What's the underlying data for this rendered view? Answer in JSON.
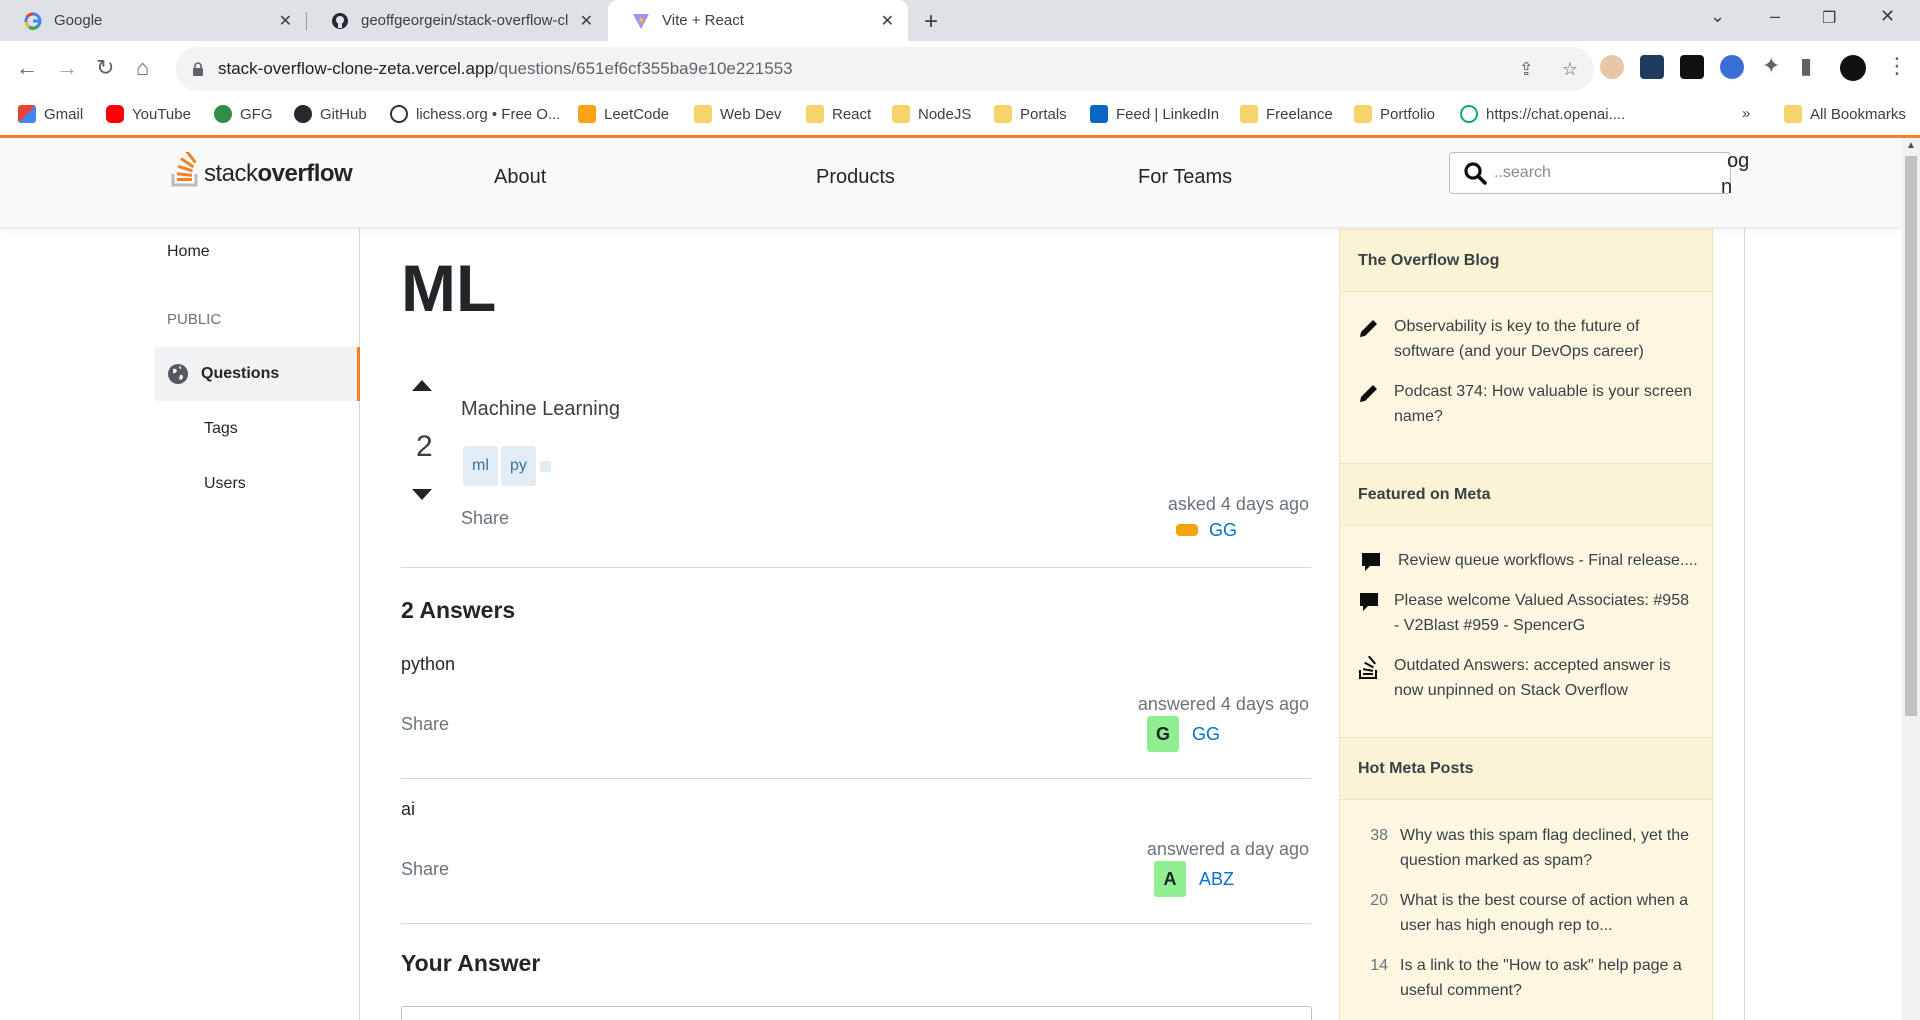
{
  "browser": {
    "tabs": [
      {
        "title": "Google",
        "icon": "google-icon"
      },
      {
        "title": "geoffgeorgein/stack-overflow-cl",
        "icon": "github-icon"
      },
      {
        "title": "Vite + React",
        "icon": "vite-icon",
        "active": true
      }
    ],
    "url_host": "stack-overflow-clone-zeta.vercel.app",
    "url_path": "/questions/651ef6cf355ba9e10e221553",
    "bookmarks": [
      {
        "label": "Gmail",
        "icon": "gmail-icon"
      },
      {
        "label": "YouTube",
        "icon": "youtube-icon"
      },
      {
        "label": "GFG",
        "icon": "gfg-icon"
      },
      {
        "label": "GitHub",
        "icon": "github-icon"
      },
      {
        "label": "lichess.org • Free O...",
        "icon": "lichess-icon"
      },
      {
        "label": "LeetCode",
        "icon": "leetcode-icon"
      },
      {
        "label": "Web Dev",
        "icon": "folder-icon"
      },
      {
        "label": "React",
        "icon": "folder-icon"
      },
      {
        "label": "NodeJS",
        "icon": "folder-icon"
      },
      {
        "label": "Portals",
        "icon": "folder-icon"
      },
      {
        "label": "Feed | LinkedIn",
        "icon": "linkedin-icon"
      },
      {
        "label": "Freelance",
        "icon": "folder-icon"
      },
      {
        "label": "Portfolio",
        "icon": "folder-icon"
      },
      {
        "label": "https://chat.openai....",
        "icon": "openai-icon"
      }
    ],
    "more_bookmarks": "»",
    "all_bookmarks": "All Bookmarks"
  },
  "header": {
    "logo_light": "stack",
    "logo_bold": "overflow",
    "nav": [
      "About",
      "Products",
      "For Teams"
    ],
    "search_placeholder": "..search",
    "login_peek_line1": "og",
    "login_peek_line2": "n"
  },
  "left_nav": {
    "home": "Home",
    "public": "PUBLIC",
    "questions": "Questions",
    "tags": "Tags",
    "users": "Users"
  },
  "question": {
    "title": "ML",
    "votes": "2",
    "body": "Machine Learning",
    "tags": [
      "ml",
      "py"
    ],
    "share": "Share",
    "asked": "asked 4 days ago",
    "user": "GG"
  },
  "answers": {
    "heading": "2 Answers",
    "items": [
      {
        "body": "python",
        "share": "Share",
        "time": "answered 4 days ago",
        "avatar": "G",
        "user": "GG"
      },
      {
        "body": "ai",
        "share": "Share",
        "time": "answered a day ago",
        "avatar": "A",
        "user": "ABZ"
      }
    ],
    "your_answer": "Your Answer"
  },
  "sidebar": {
    "blog_heading": "The Overflow Blog",
    "blog_items": [
      "Observability is key to the future of software (and your DevOps career)",
      "Podcast 374: How valuable is your screen name?"
    ],
    "meta_heading": "Featured on Meta",
    "meta_items": [
      "Review queue workflows - Final release....",
      "Please welcome Valued Associates: #958 - V2Blast #959 - SpencerG",
      "Outdated Answers: accepted answer is now unpinned on Stack Overflow"
    ],
    "hot_heading": "Hot Meta Posts",
    "hot_items": [
      {
        "count": "38",
        "text": "Why was this spam flag declined, yet the question marked as spam?"
      },
      {
        "count": "20",
        "text": "What is the best course of action when a user has high enough rep to..."
      },
      {
        "count": "14",
        "text": "Is a link to the \"How to ask\" help page a useful comment?"
      }
    ]
  },
  "colors": {
    "accent": "#f48225",
    "link": "#0074cc",
    "widget_bg": "#fdf7e2",
    "avatar": "#90ee90"
  }
}
